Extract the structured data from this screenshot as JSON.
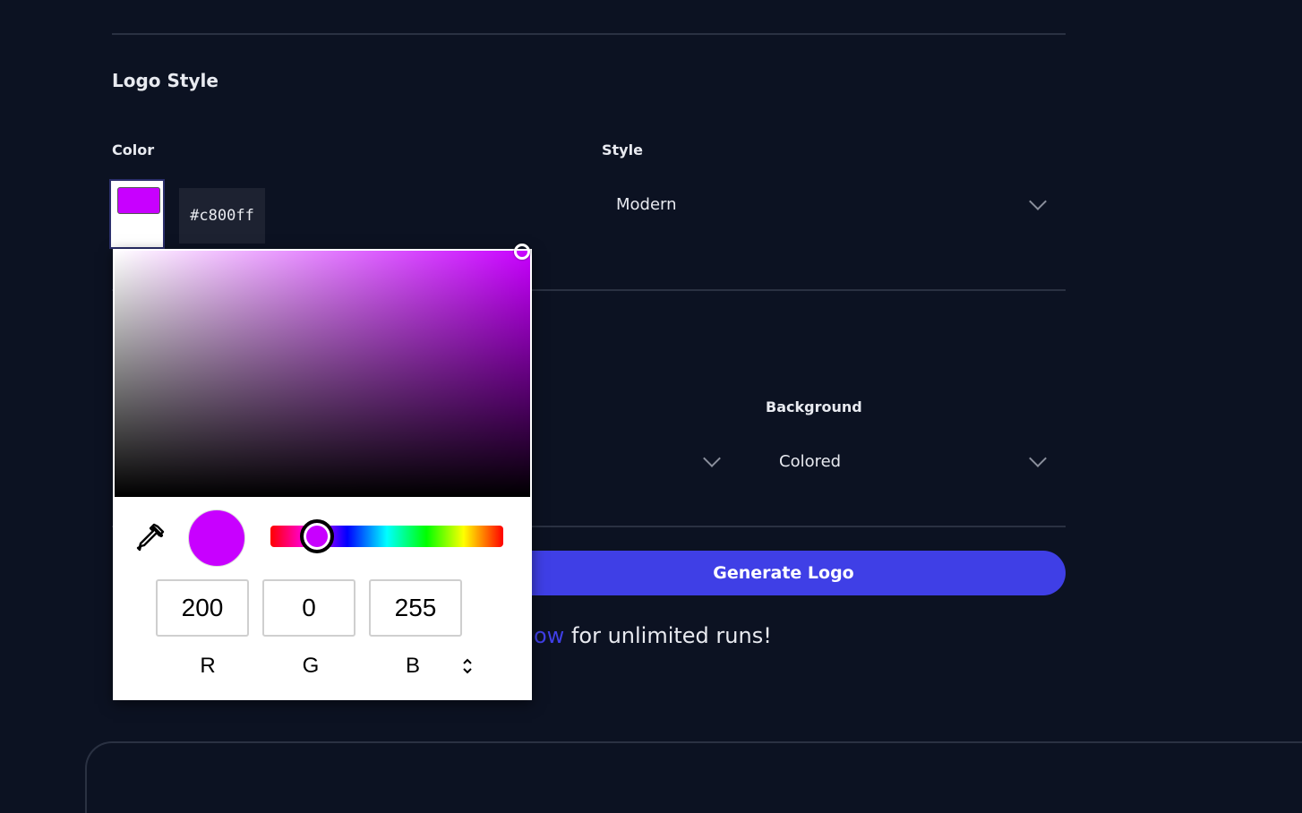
{
  "logo_style": {
    "title": "Logo Style",
    "color_label": "Color",
    "color_hex": "#c800ff",
    "style_label": "Style",
    "style_value": "Modern"
  },
  "second_row": {
    "background_label": "Background",
    "background_value": "Colored"
  },
  "generate_button": "Generate Logo",
  "promo": {
    "link_text": "ow",
    "text": " for unlimited runs!"
  },
  "picker": {
    "selected_color": "#c800ff",
    "r": "200",
    "g": "0",
    "b": "255",
    "r_label": "R",
    "g_label": "G",
    "b_label": "B",
    "icons": [
      "eyedropper-icon",
      "chevron-updown-icon",
      "chevron-down-icon"
    ]
  },
  "colors": {
    "background": "#0c1222",
    "accent": "#3f3fe6",
    "input_bg": "#1d2231"
  }
}
